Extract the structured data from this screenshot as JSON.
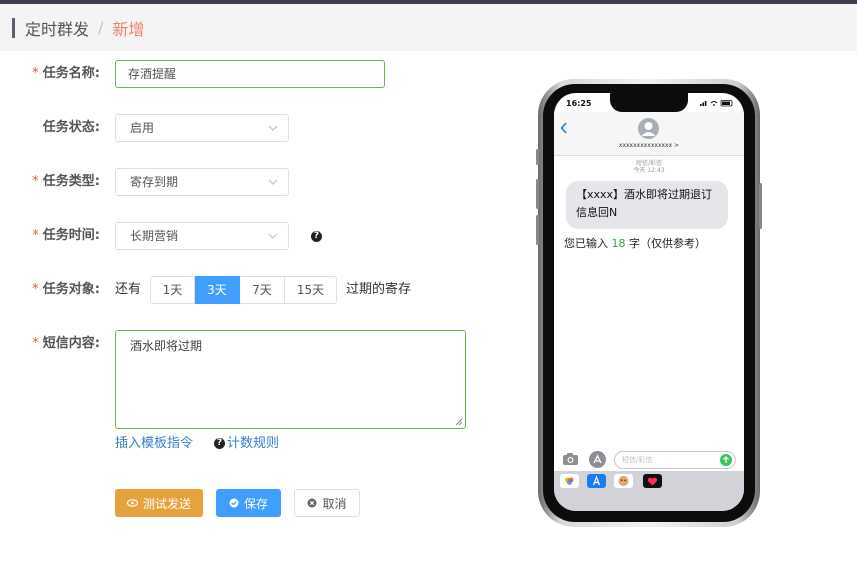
{
  "breadcrumb": {
    "parent": "定时群发",
    "separator": "/",
    "current": "新增"
  },
  "form": {
    "task_name": {
      "label": "任务名称:",
      "value": "存酒提醒",
      "required": true
    },
    "task_status": {
      "label": "任务状态:",
      "value": "启用",
      "required": false
    },
    "task_type": {
      "label": "任务类型:",
      "value": "寄存到期",
      "required": true
    },
    "task_time": {
      "label": "任务时间:",
      "value": "长期营销",
      "required": true,
      "help_icon": "question-circle-icon"
    },
    "task_target": {
      "label": "任务对象:",
      "required": true,
      "prefix": "还有",
      "suffix": "过期的寄存",
      "options": [
        "1天",
        "3天",
        "7天",
        "15天"
      ],
      "selected": "3天"
    },
    "sms_content": {
      "label": "短信内容:",
      "value": "酒水即将过期",
      "required": true
    },
    "links": {
      "insert_template": "插入模板指令",
      "count_rule": "计数规则"
    },
    "buttons": {
      "test_send": "测试发送",
      "save": "保存",
      "cancel": "取消"
    }
  },
  "phone_preview": {
    "status_time": "16:25",
    "contact_name": "xxxxxxxxxxxxxxx >",
    "meta_line1": "短信/彩信",
    "meta_line2": "今天 12:43",
    "message": "【xxxx】酒水即将过期退订信息回N",
    "count_prefix": "您已输入",
    "count_value": "18",
    "count_suffix": "字（仅供参考）",
    "input_placeholder": "短信/彩信"
  },
  "colors": {
    "accent_blue": "#409eff",
    "orange": "#e6a23c",
    "required_red": "#e8574a",
    "valid_green": "#67b84b",
    "breadcrumb_current": "#f0826e"
  }
}
